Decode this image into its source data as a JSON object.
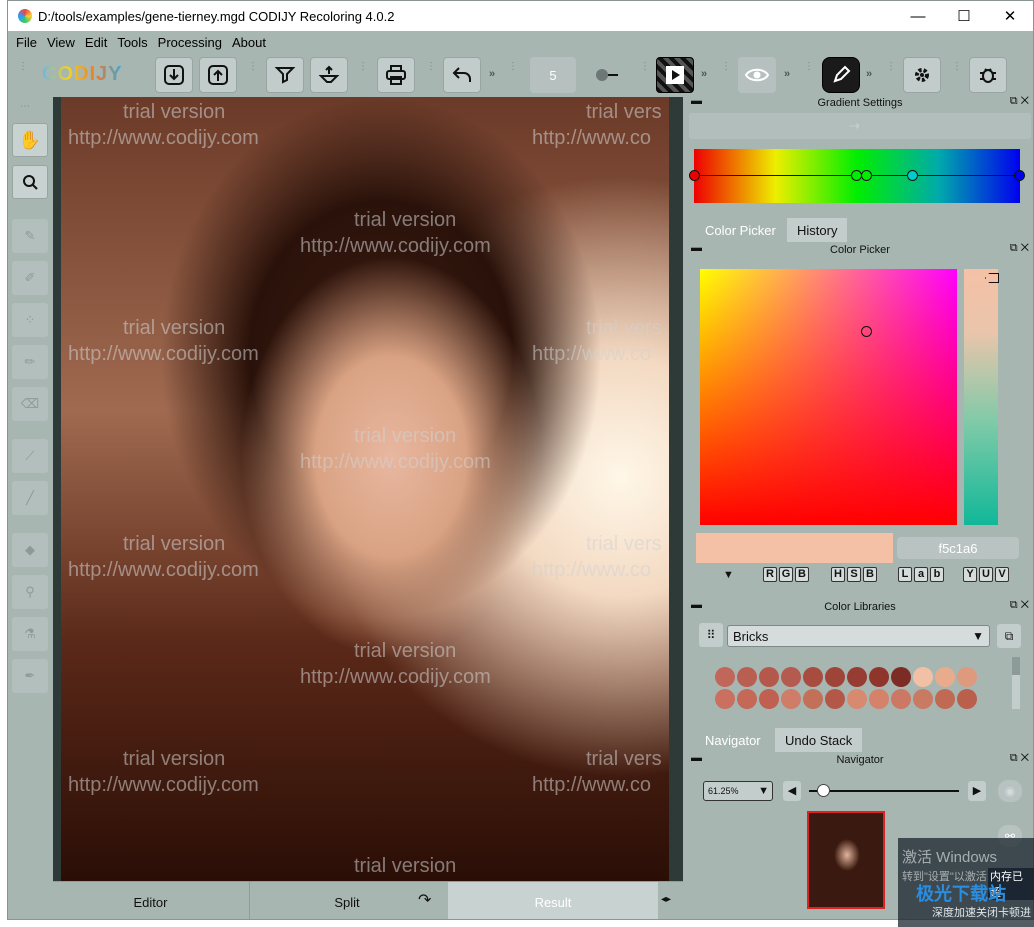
{
  "window": {
    "title": "D:/tools/examples/gene-tierney.mgd CODIJY Recoloring 4.0.2",
    "minimize": "—",
    "maximize": "☐",
    "close": "✕"
  },
  "menu": [
    "File",
    "View",
    "Edit",
    "Tools",
    "Processing",
    "About"
  ],
  "logo": "CODIJY",
  "toolbar": {
    "brush_size": "5",
    "chevron": "»"
  },
  "canvas": {
    "watermark_trial": "trial version",
    "watermark_url": "http://www.codijy.com",
    "watermark_url_short": "http://www.co",
    "watermark_trial_short": "trial vers"
  },
  "bottom_tabs": {
    "editor": "Editor",
    "split": "Split",
    "result": "Result"
  },
  "gradient": {
    "title": "Gradient Settings"
  },
  "color_picker": {
    "tab_picker": "Color Picker",
    "tab_history": "History",
    "title": "Color Picker",
    "hex": "f5c1a6",
    "current_color": "#f5c1a6",
    "modes": [
      [
        "R",
        "G",
        "B"
      ],
      [
        "H",
        "S",
        "B"
      ],
      [
        "L",
        "a",
        "b"
      ],
      [
        "Y",
        "U",
        "V"
      ]
    ]
  },
  "libraries": {
    "title": "Color Libraries",
    "selected": "Bricks",
    "swatches_row1": [
      "#c0675a",
      "#b95f52",
      "#b3584b",
      "#b55a4e",
      "#a84c40",
      "#9e4438",
      "#963c32",
      "#8f352c",
      "#7c2c24",
      "#f2c0a4",
      "#e8ac8c",
      "#dd9a7c"
    ],
    "swatches_row2": [
      "#c97060",
      "#c46858",
      "#bf6050",
      "#cf7c68",
      "#c27058",
      "#b35848",
      "#d88a70",
      "#d4826a",
      "#cc7864",
      "#c97a62",
      "#c06a54",
      "#b95f4c"
    ]
  },
  "navigator": {
    "tab_navigator": "Navigator",
    "tab_undo": "Undo Stack",
    "title": "Navigator",
    "zoom": "61.25%"
  },
  "overlay": {
    "line1": "激活 Windows",
    "line2": "转到\"设置\"以激活",
    "line3": "内存已超",
    "line4": "极光下载站",
    "line5": "深度加速关闭卡顿进"
  }
}
